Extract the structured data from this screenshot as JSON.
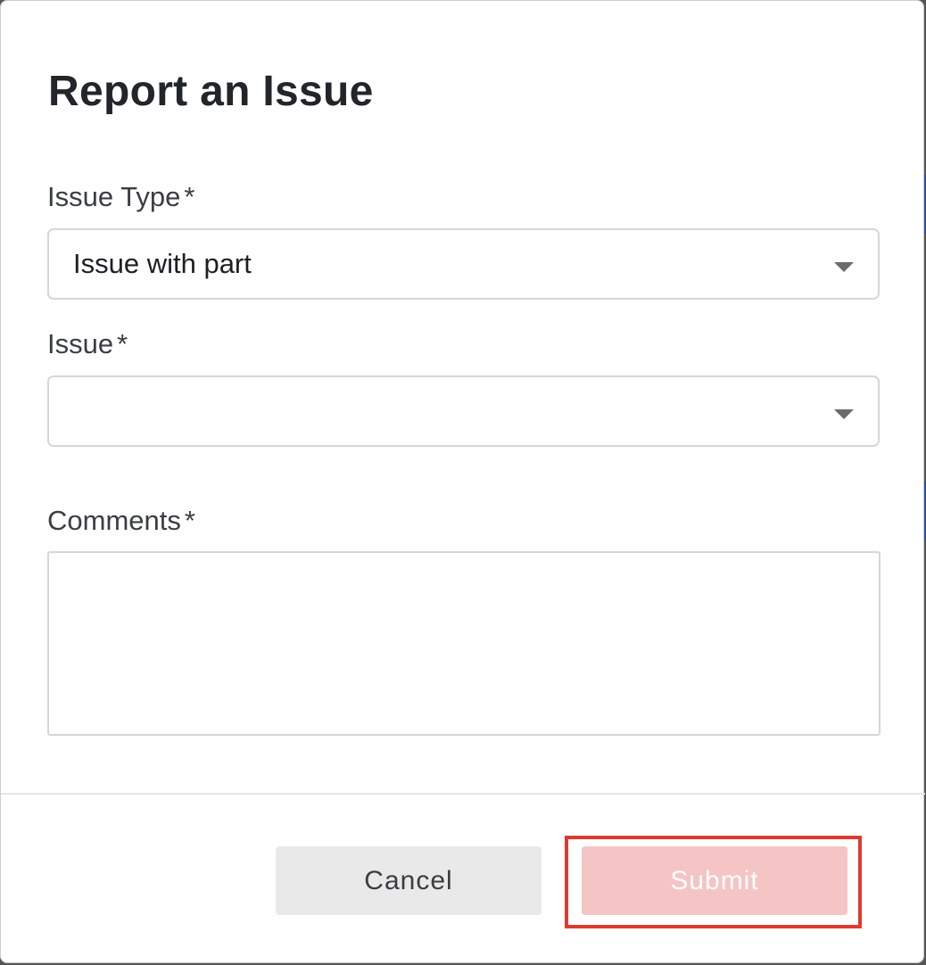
{
  "dialog": {
    "title": "Report an Issue"
  },
  "form": {
    "issue_type": {
      "label": "Issue Type",
      "required_marker": "*",
      "selected_value": "Issue with part"
    },
    "issue": {
      "label": "Issue",
      "required_marker": "*",
      "selected_value": ""
    },
    "comments": {
      "label": "Comments",
      "required_marker": "*",
      "value": ""
    }
  },
  "footer": {
    "cancel_label": "Cancel",
    "submit_label": "Submit"
  },
  "colors": {
    "submit_disabled_bg": "#f5c4c4",
    "cancel_bg": "#e9e9e9",
    "highlight_outline": "#e03a2f",
    "edge_accent": "#2b4aa8"
  },
  "icons": {
    "dropdown": "caret-down-icon"
  }
}
